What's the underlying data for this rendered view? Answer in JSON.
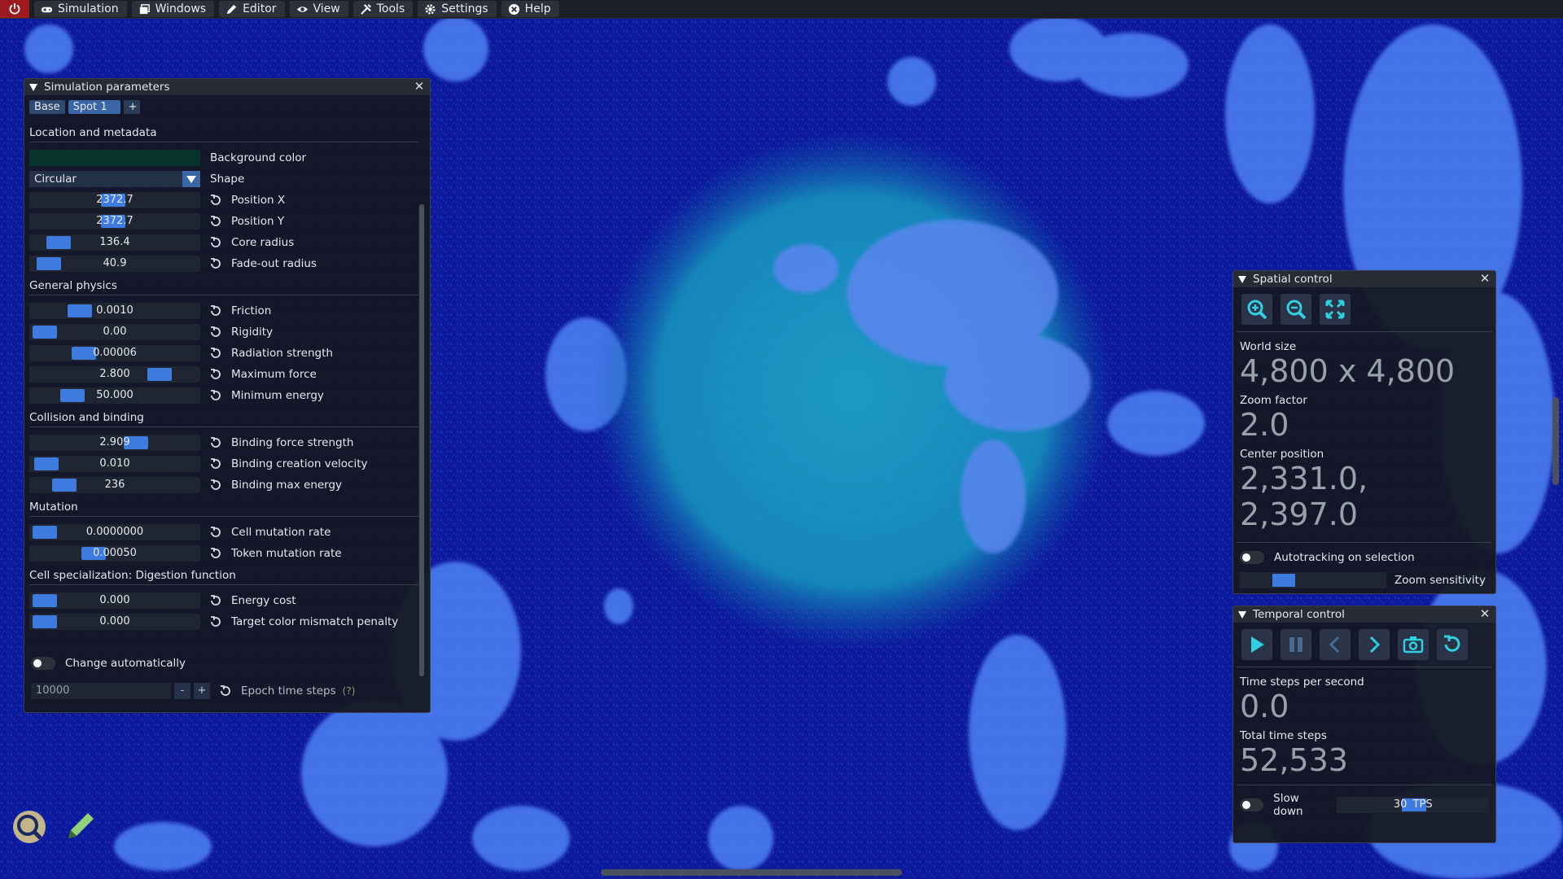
{
  "menubar": {
    "items": [
      {
        "label": "Simulation",
        "icon": "gamepad-icon"
      },
      {
        "label": "Windows",
        "icon": "windows-icon"
      },
      {
        "label": "Editor",
        "icon": "pencil-icon"
      },
      {
        "label": "View",
        "icon": "eye-icon"
      },
      {
        "label": "Tools",
        "icon": "tools-icon"
      },
      {
        "label": "Settings",
        "icon": "gear-icon"
      },
      {
        "label": "Help",
        "icon": "help-icon"
      }
    ]
  },
  "sim_params": {
    "title": "Simulation parameters",
    "tabs": [
      "Base",
      "Spot 1",
      "+"
    ],
    "sections": {
      "location": "Location and metadata",
      "physics": "General physics",
      "collision": "Collision and binding",
      "mutation": "Mutation",
      "digestion": "Cell specialization: Digestion function"
    },
    "background_color_label": "Background color",
    "background_color": "#08332a",
    "shape_value": "Circular",
    "shape_label": "Shape",
    "rows": {
      "position_x": {
        "value": "2372.7",
        "label": "Position X",
        "level": 0.49
      },
      "position_y": {
        "value": "2372.7",
        "label": "Position Y",
        "level": 0.49
      },
      "core_radius": {
        "value": "136.4",
        "label": "Core radius",
        "level": 0.1
      },
      "fadeout_radius": {
        "value": "40.9",
        "label": "Fade-out radius",
        "level": 0.03
      },
      "friction": {
        "value": "0.0010",
        "label": "Friction",
        "level": 0.25
      },
      "rigidity": {
        "value": "0.00",
        "label": "Rigidity",
        "level": 0.0
      },
      "radiation": {
        "value": "0.00006",
        "label": "Radiation strength",
        "level": 0.28
      },
      "max_force": {
        "value": "2.800",
        "label": "Maximum force",
        "level": 0.82
      },
      "min_energy": {
        "value": "50.000",
        "label": "Minimum energy",
        "level": 0.2
      },
      "binding_force": {
        "value": "2.909",
        "label": "Binding force strength",
        "level": 0.65
      },
      "binding_velocity": {
        "value": "0.010",
        "label": "Binding creation velocity",
        "level": 0.01
      },
      "binding_energy": {
        "value": "236",
        "label": "Binding max energy",
        "level": 0.14
      },
      "cell_mutation": {
        "value": "0.0000000",
        "label": "Cell mutation rate",
        "level": 0.0
      },
      "token_mutation": {
        "value": "0.00050",
        "label": "Token mutation rate",
        "level": 0.35
      },
      "energy_cost": {
        "value": "0.000",
        "label": "Energy cost",
        "level": 0.0
      },
      "color_mismatch": {
        "value": "0.000",
        "label": "Target color mismatch penalty",
        "level": 0.0
      }
    },
    "change_auto_label": "Change automatically",
    "epoch_value": "10000",
    "epoch_minus": "-",
    "epoch_plus": "+",
    "epoch_label": "Epoch time steps",
    "epoch_help": "(?)"
  },
  "spatial": {
    "title": "Spatial control",
    "world_size_label": "World size",
    "world_size": "4,800 x 4,800",
    "zoom_label": "Zoom factor",
    "zoom": "2.0",
    "center_label": "Center position",
    "center": "2,331.0, 2,397.0",
    "autotracking_label": "Autotracking on selection",
    "zoom_sensitivity_label": "Zoom sensitivity",
    "zoom_sensitivity_level": 0.25
  },
  "temporal": {
    "title": "Temporal control",
    "tps_label": "Time steps per second",
    "tps": "0.0",
    "total_label": "Total time steps",
    "total": "52,533",
    "slow_down_label": "Slow down",
    "slow_down_value": "30",
    "slow_down_unit": "TPS",
    "slow_down_level": 0.5
  },
  "colors": {
    "accent": "#3d7be0",
    "world_background": "#0c1a9c",
    "spot": "#1aa7c9",
    "close_red": "#9d1b1f"
  }
}
